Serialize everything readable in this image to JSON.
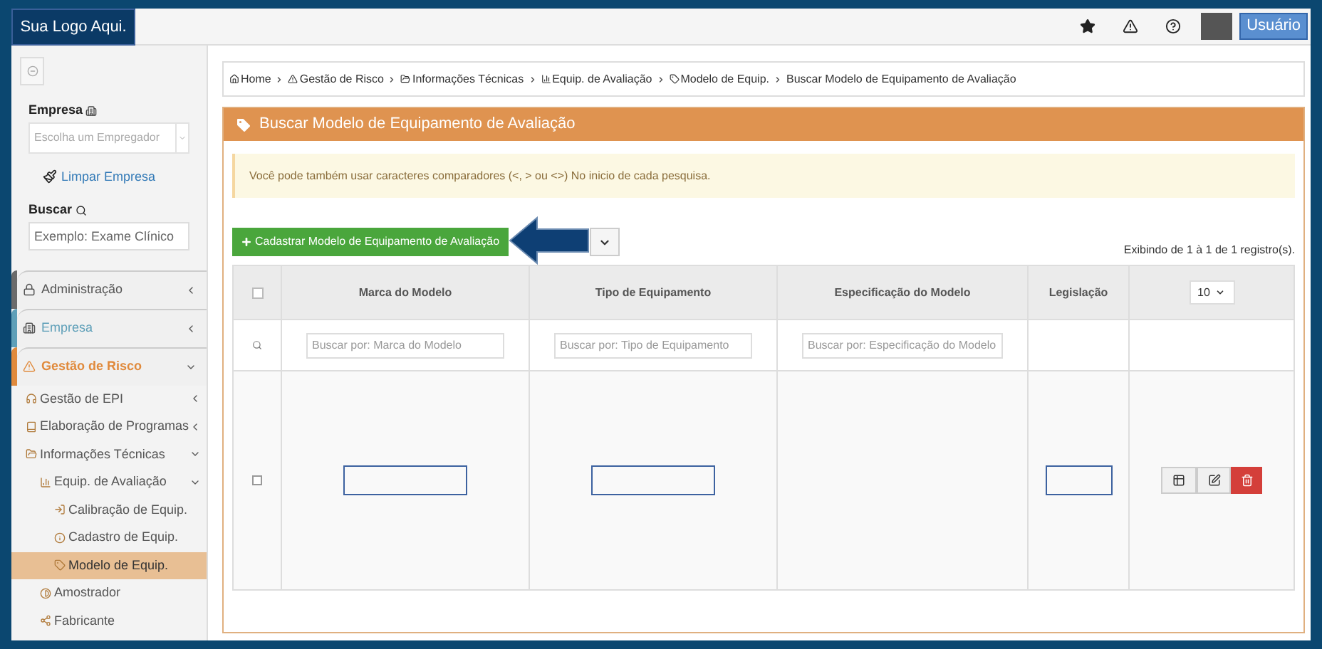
{
  "logo": "Sua Logo Aqui.",
  "topbar": {
    "user_label": "Usuário"
  },
  "sidebar": {
    "company_label": "Empresa",
    "company_select": {
      "placeholder": "Escolha um Empregador"
    },
    "clear_link": "Limpar Empresa",
    "search_label": "Buscar",
    "search": {
      "placeholder": "Exemplo: Exame Clínico"
    },
    "menu": [
      {
        "label": "Administração",
        "color": "#6b6b6b",
        "expanded": false
      },
      {
        "label": "Empresa",
        "color": "#5e9fb8",
        "expanded": false
      },
      {
        "label": "Gestão de Risco",
        "color": "#e08a3c",
        "expanded": true,
        "children": [
          {
            "label": "Gestão de EPI",
            "expanded": false,
            "selected": false
          },
          {
            "label": "Elaboração de Programas",
            "expanded": false,
            "selected": false
          },
          {
            "label": "Informações Técnicas",
            "expanded": true,
            "selected": false,
            "children": [
              {
                "label": "Equip. de Avaliação",
                "expanded": true,
                "selected": false,
                "children": [
                  {
                    "label": "Calibração de Equip.",
                    "selected": false
                  },
                  {
                    "label": "Cadastro de Equip.",
                    "selected": false
                  },
                  {
                    "label": "Modelo de Equip.",
                    "selected": true
                  }
                ]
              },
              {
                "label": "Amostrador",
                "selected": false
              },
              {
                "label": "Fabricante",
                "selected": false
              }
            ]
          }
        ]
      }
    ]
  },
  "breadcrumb": [
    "Home",
    "Gestão de Risco",
    "Informações Técnicas",
    "Equip. de Avaliação",
    "Modelo de Equip.",
    "Buscar Modelo de Equipamento de Avaliação"
  ],
  "panel": {
    "title": "Buscar Modelo de Equipamento de Avaliação",
    "alert": "Você pode também usar caracteres comparadores (<, > ou <>) No inicio de cada pesquisa.",
    "new_button": "Cadastrar Modelo de Equipamento de Avaliação",
    "records_info": "Exibindo de 1 à 1 de 1 registro(s).",
    "table": {
      "select_all_checked": false,
      "columns": [
        "Marca do Modelo",
        "Tipo de Equipamento",
        "Especificação do Modelo",
        "Legislação"
      ],
      "page_size": "10",
      "filters": [
        {
          "placeholder": "Buscar por: Marca do Modelo"
        },
        {
          "placeholder": "Buscar por: Tipo de Equipamento"
        },
        {
          "placeholder": "Buscar por: Especificação do Modelo"
        }
      ],
      "rows": [
        {
          "checked": false,
          "highlights": [
            true,
            true,
            false,
            true
          ]
        }
      ]
    }
  }
}
